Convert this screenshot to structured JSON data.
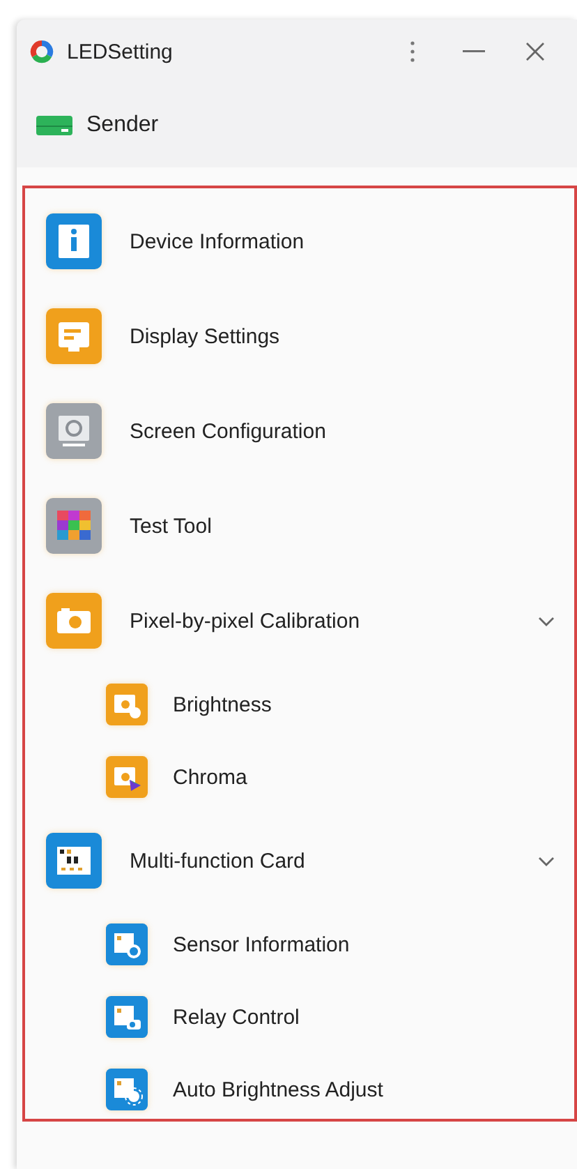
{
  "window": {
    "title": "LEDSetting"
  },
  "device": {
    "label": "Sender"
  },
  "menu": [
    {
      "label": "Device Information",
      "color": "#1a8ad8"
    },
    {
      "label": "Display Settings",
      "color": "#f0a01c"
    },
    {
      "label": "Screen Configuration",
      "color": "#9ea3a9"
    },
    {
      "label": "Test Tool",
      "color": "#9ea3a9"
    },
    {
      "label": "Pixel-by-pixel Calibration",
      "color": "#f0a01c",
      "expanded": true,
      "children": [
        {
          "label": "Brightness",
          "color": "#f0a01c"
        },
        {
          "label": "Chroma",
          "color": "#f0a01c"
        }
      ]
    },
    {
      "label": "Multi-function Card",
      "color": "#1a8ad8",
      "expanded": true,
      "children": [
        {
          "label": "Sensor Information",
          "color": "#1a8ad8"
        },
        {
          "label": "Relay Control",
          "color": "#1a8ad8"
        },
        {
          "label": "Auto Brightness Adjust",
          "color": "#1a8ad8"
        }
      ]
    }
  ]
}
